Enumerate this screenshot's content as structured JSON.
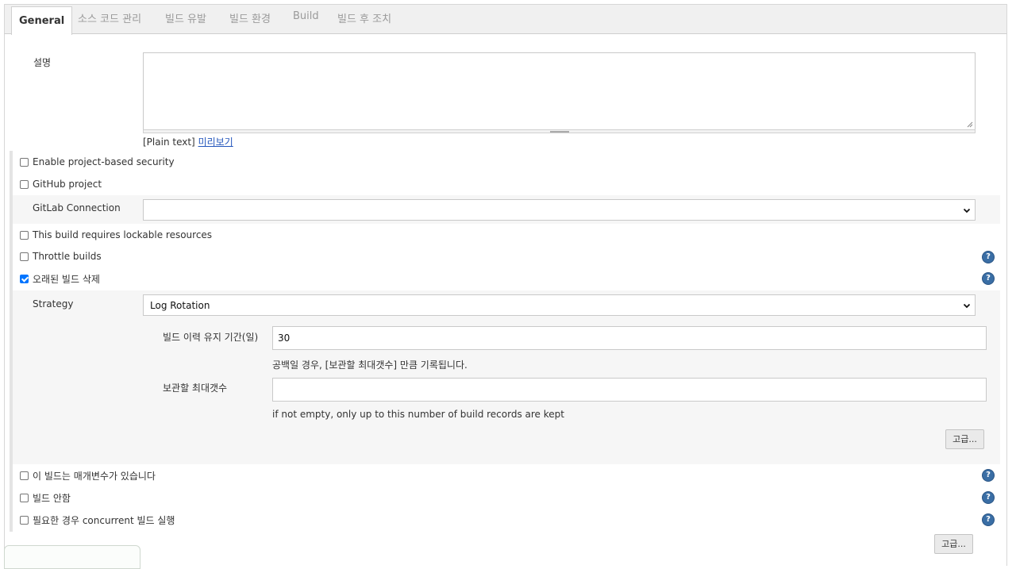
{
  "tabs": [
    "General",
    "소스 코드 관리",
    "빌드 유발",
    "빌드 환경",
    "Build",
    "빌드 후 조치"
  ],
  "description": {
    "label": "설명",
    "value": "",
    "format_text": "[Plain text]",
    "preview_link": "미리보기"
  },
  "options": {
    "project_security": "Enable project-based security",
    "github_project": "GitHub project",
    "gitlab_connection_label": "GitLab Connection",
    "gitlab_connection_value": "",
    "lockable_resources": "This build requires lockable resources",
    "throttle_builds": "Throttle builds",
    "discard_old_builds": "오래된 빌드 삭제"
  },
  "strategy": {
    "label": "Strategy",
    "value": "Log Rotation",
    "days_label": "빌드 이력 유지 기간(일)",
    "days_value": "30",
    "days_hint": "공백일 경우, [보관할 최대갯수] 만큼 기록됩니다.",
    "max_label": "보관할 최대갯수",
    "max_value": "",
    "max_hint": "if not empty, only up to this number of build records are kept",
    "advanced_button": "고급..."
  },
  "more_options": {
    "parameterized": "이 빌드는 매개변수가 있습니다",
    "disable_build": "빌드 안함",
    "concurrent": "필요한 경우 concurrent 빌드 실행",
    "advanced_button": "고급..."
  },
  "help_glyph": "?",
  "colors": {
    "checkbox_accent": "#0075ff",
    "help_icon": "#3a6ea5",
    "link": "#2255bb"
  }
}
